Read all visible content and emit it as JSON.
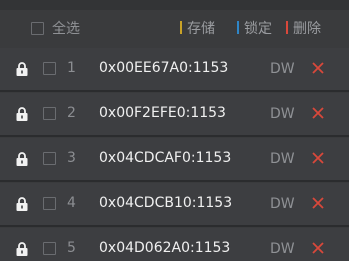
{
  "colors": {
    "background": "#3a3b3d",
    "row_background": "#3d3e41",
    "save_accent": "#c9a227",
    "lock_accent": "#2e86c8",
    "delete_accent": "#d9483b"
  },
  "toolbar": {
    "select_all_label": "全选",
    "save_label": "存储",
    "lock_label": "锁定",
    "delete_label": "删除"
  },
  "rows": [
    {
      "index": "1",
      "address": "0x00EE67A0:1153",
      "type": "DW",
      "locked": true,
      "icon": "lock-icon"
    },
    {
      "index": "2",
      "address": "0x00F2EFE0:1153",
      "type": "DW",
      "locked": true,
      "icon": "lock-icon"
    },
    {
      "index": "3",
      "address": "0x04CDCAF0:1153",
      "type": "DW",
      "locked": true,
      "icon": "lock-icon"
    },
    {
      "index": "4",
      "address": "0x04CDCB10:1153",
      "type": "DW",
      "locked": true,
      "icon": "lock-icon"
    },
    {
      "index": "5",
      "address": "0x04D062A0:1153",
      "type": "DW",
      "locked": true,
      "icon": "lock-icon"
    }
  ]
}
